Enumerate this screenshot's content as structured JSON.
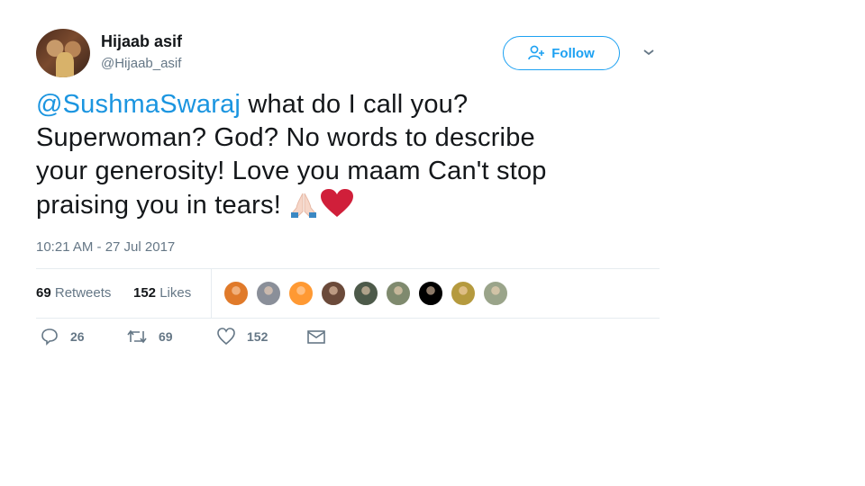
{
  "tweet": {
    "author_name": "Hijaab asif",
    "author_handle": "@Hijaab_asif",
    "follow_label": "Follow",
    "mention": "@SushmaSwaraj",
    "body_line1_rest": " what do I call you?",
    "body_line2": "Superwoman? God? No words to describe",
    "body_line3": "your generosity! Love you maam Can't stop",
    "body_line4": "praising you in tears!",
    "emojis": [
      "folded-hands-emoji",
      "red-heart-emoji"
    ],
    "timestamp": "10:21 AM - 27 Jul 2017"
  },
  "stats": {
    "retweets_count": "69",
    "retweets_label": "Retweets",
    "likes_count": "152",
    "likes_label": "Likes",
    "liker_avatar_colors": [
      "#e07a2a",
      "#8a8f99",
      "#ff9933",
      "#6b4a3a",
      "#4d5a4a",
      "#7f8a6e",
      "#000000",
      "#b59a3e",
      "#9aa48a"
    ]
  },
  "actions": {
    "reply_count": "26",
    "retweet_count": "69",
    "like_count": "152"
  },
  "colors": {
    "accent": "#1da1f2",
    "mention": "#1b95e0",
    "muted": "#657786",
    "heart": "#d01f3a"
  }
}
